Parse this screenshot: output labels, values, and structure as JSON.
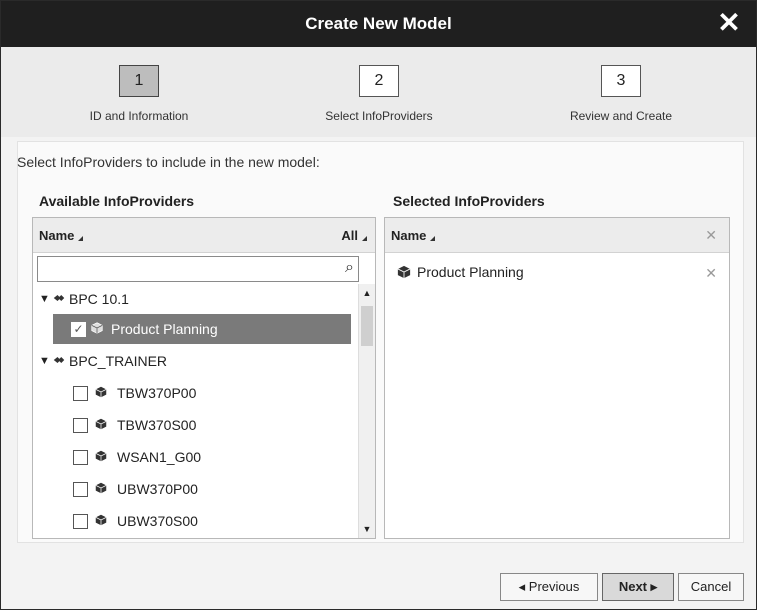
{
  "dialog": {
    "title": "Create New Model",
    "close_glyph": "✕"
  },
  "steps": [
    {
      "num": "1",
      "label": "ID and Information",
      "active": true
    },
    {
      "num": "2",
      "label": "Select InfoProviders",
      "active": false
    },
    {
      "num": "3",
      "label": "Review and Create",
      "active": false
    }
  ],
  "intro": "Select InfoProviders to include in the new model:",
  "available": {
    "heading": "Available InfoProviders",
    "col_name": "Name",
    "col_all": "All",
    "search_value": "",
    "tree": [
      {
        "type": "group",
        "label": "BPC 10.1"
      },
      {
        "type": "item",
        "label": "Product Planning",
        "checked": true,
        "selected": true
      },
      {
        "type": "group",
        "label": "BPC_TRAINER"
      },
      {
        "type": "item",
        "label": "TBW370P00",
        "checked": false
      },
      {
        "type": "item",
        "label": "TBW370S00",
        "checked": false
      },
      {
        "type": "item",
        "label": "WSAN1_G00",
        "checked": false
      },
      {
        "type": "item",
        "label": "UBW370P00",
        "checked": false
      },
      {
        "type": "item",
        "label": "UBW370S00",
        "checked": false
      }
    ]
  },
  "selected": {
    "heading": "Selected InfoProviders",
    "col_name": "Name",
    "items": [
      {
        "label": "Product Planning"
      }
    ]
  },
  "footer": {
    "previous": "◂  Previous",
    "next": "Next  ▸",
    "cancel": "Cancel"
  }
}
